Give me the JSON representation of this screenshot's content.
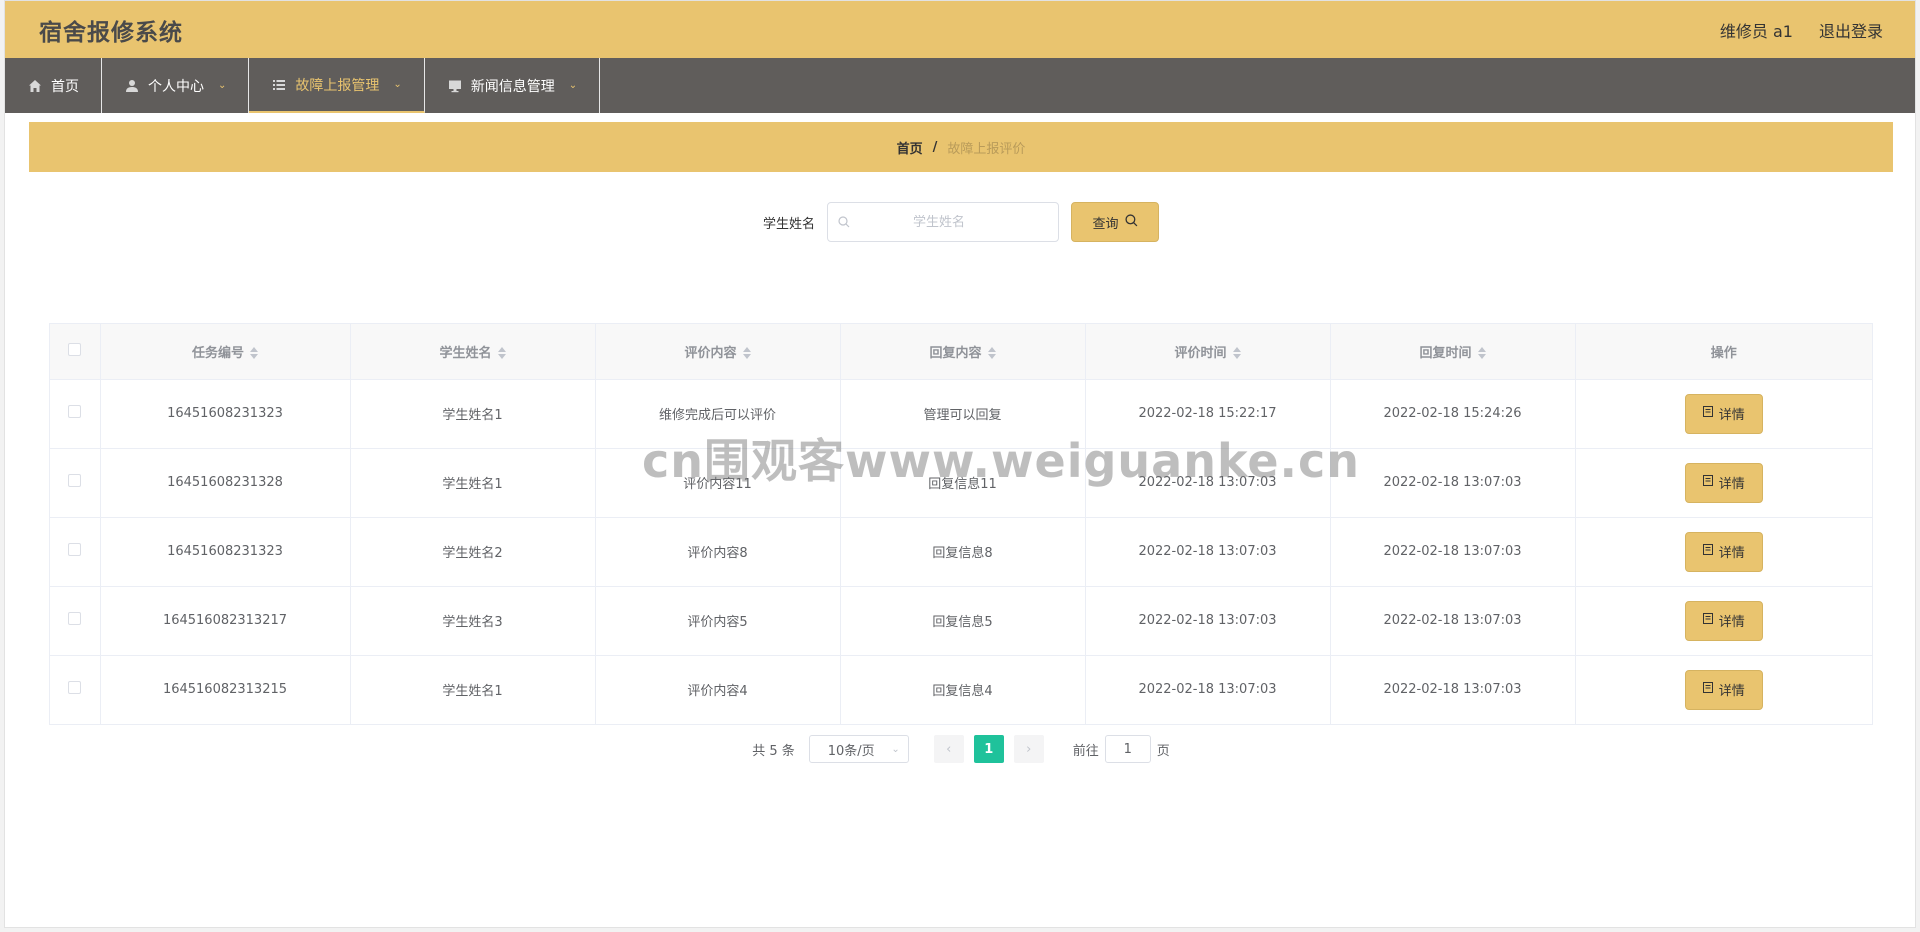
{
  "header": {
    "title": "宿舍报修系统",
    "user_label": "维修员 a1",
    "logout_label": "退出登录"
  },
  "nav": {
    "items": [
      {
        "label": "首页",
        "icon": "home-icon",
        "has_caret": false
      },
      {
        "label": "个人中心",
        "icon": "user-icon",
        "has_caret": true
      },
      {
        "label": "故障上报管理",
        "icon": "list-icon",
        "has_caret": true,
        "active": true
      },
      {
        "label": "新闻信息管理",
        "icon": "monitor-icon",
        "has_caret": true
      }
    ]
  },
  "breadcrumb": {
    "home": "首页",
    "separator": "/",
    "current": "故障上报评价"
  },
  "search": {
    "label": "学生姓名",
    "placeholder": "学生姓名",
    "value": "",
    "button_label": "查询"
  },
  "table": {
    "columns": [
      "任务编号",
      "学生姓名",
      "评价内容",
      "回复内容",
      "评价时间",
      "回复时间",
      "操作"
    ],
    "rows": [
      {
        "task_no": "16451608231323",
        "student": "学生姓名1",
        "review": "维修完成后可以评价",
        "reply": "管理可以回复",
        "review_time": "2022-02-18 15:22:17",
        "reply_time": "2022-02-18 15:24:26",
        "action": "详情"
      },
      {
        "task_no": "16451608231328",
        "student": "学生姓名1",
        "review": "评价内容11",
        "reply": "回复信息11",
        "review_time": "2022-02-18 13:07:03",
        "reply_time": "2022-02-18 13:07:03",
        "action": "详情"
      },
      {
        "task_no": "16451608231323",
        "student": "学生姓名2",
        "review": "评价内容8",
        "reply": "回复信息8",
        "review_time": "2022-02-18 13:07:03",
        "reply_time": "2022-02-18 13:07:03",
        "action": "详情"
      },
      {
        "task_no": "164516082313217",
        "student": "学生姓名3",
        "review": "评价内容5",
        "reply": "回复信息5",
        "review_time": "2022-02-18 13:07:03",
        "reply_time": "2022-02-18 13:07:03",
        "action": "详情"
      },
      {
        "task_no": "164516082313215",
        "student": "学生姓名1",
        "review": "评价内容4",
        "reply": "回复信息4",
        "review_time": "2022-02-18 13:07:03",
        "reply_time": "2022-02-18 13:07:03",
        "action": "详情"
      }
    ]
  },
  "pagination": {
    "total": "共 5 条",
    "page_size": "10条/页",
    "current_page": "1",
    "goto_label": "前往",
    "goto_value": "1",
    "goto_suffix": "页"
  },
  "watermark": "cn围观客www.weiguanke.cn",
  "colors": {
    "accent": "#e9c46f",
    "nav_bg": "#605d5b",
    "page_active": "#1fc29b"
  }
}
